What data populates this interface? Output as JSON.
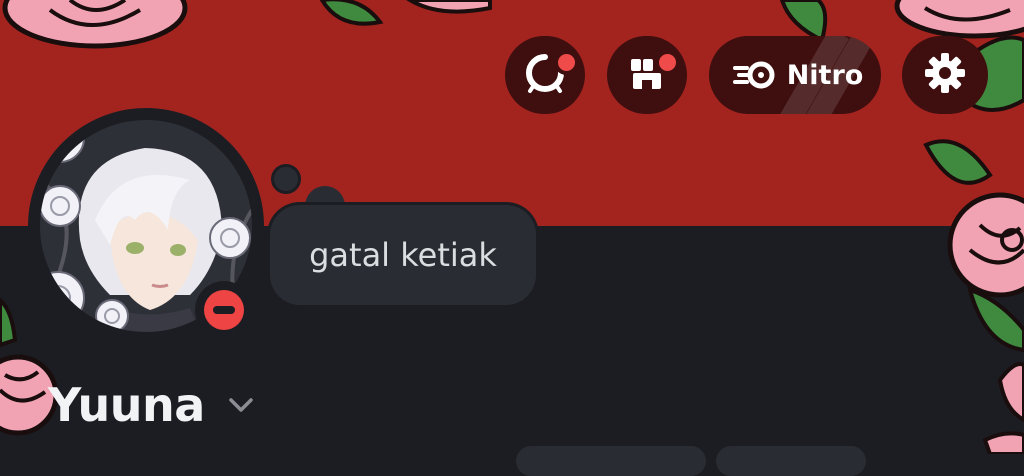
{
  "header": {
    "quests_icon": "quests-icon",
    "shop_icon": "shop-icon",
    "nitro_label": "Nitro",
    "settings_icon": "gear-icon"
  },
  "profile": {
    "display_name": "Yuuna",
    "custom_status": "gatal ketiak",
    "presence": "do-not-disturb",
    "dropdown_icon": "chevron-down-icon"
  },
  "colors": {
    "banner": "#a3241f",
    "background": "#1c1d22",
    "button_bg": "#3f0e0e",
    "notification_dot": "#ef4b4b",
    "dnd_status": "#ef4444",
    "bubble": "#2a2c33"
  }
}
